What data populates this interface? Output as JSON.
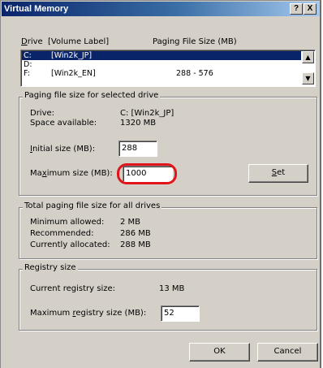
{
  "window": {
    "title": "Virtual Memory",
    "help_button": "?",
    "close_button": "X"
  },
  "drive_list": {
    "drive_header": "Drive",
    "drive_header_hotkey": "D",
    "drive_header_rest": "rive",
    "volume_header": "[Volume Label]",
    "paging_header": "Paging File Size (MB)",
    "rows": [
      {
        "drive": "C:",
        "label": "[Win2k_JP]",
        "size": "",
        "selected": true
      },
      {
        "drive": "D:",
        "label": "",
        "size": "",
        "selected": false
      },
      {
        "drive": "F:",
        "label": "[Win2k_EN]",
        "size": "288 - 576",
        "selected": false
      }
    ]
  },
  "selected_drive": {
    "group_title": "Paging file size for selected drive",
    "drive_label": "Drive:",
    "drive_value": "C:  [Win2k_JP]",
    "space_label": "Space available:",
    "space_value": "1320 MB",
    "initial_label_hotkey": "I",
    "initial_label_rest": "nitial size (MB):",
    "initial_value": "288",
    "max_label_pre": "Ma",
    "max_label_hotkey": "x",
    "max_label_rest": "imum size (MB):",
    "max_value": "1000",
    "set_hotkey": "S",
    "set_rest": "et"
  },
  "total": {
    "group_title": "Total paging file size for all drives",
    "min_label": "Minimum allowed:",
    "min_value": "2 MB",
    "rec_label": "Recommended:",
    "rec_value": "286 MB",
    "cur_label": "Currently allocated:",
    "cur_value": "288 MB"
  },
  "registry": {
    "group_title": "Registry size",
    "current_label": "Current registry size:",
    "current_value": "13 MB",
    "max_label_pre": "Maximum ",
    "max_label_hotkey": "r",
    "max_label_rest": "egistry size (MB):",
    "max_value": "52"
  },
  "buttons": {
    "ok": "OK",
    "cancel": "Cancel"
  },
  "colors": {
    "title_bar": "#0a246a",
    "dialog_bg": "#d4d0c8",
    "selection": "#0a246a",
    "highlight_circle": "#e2141b"
  }
}
